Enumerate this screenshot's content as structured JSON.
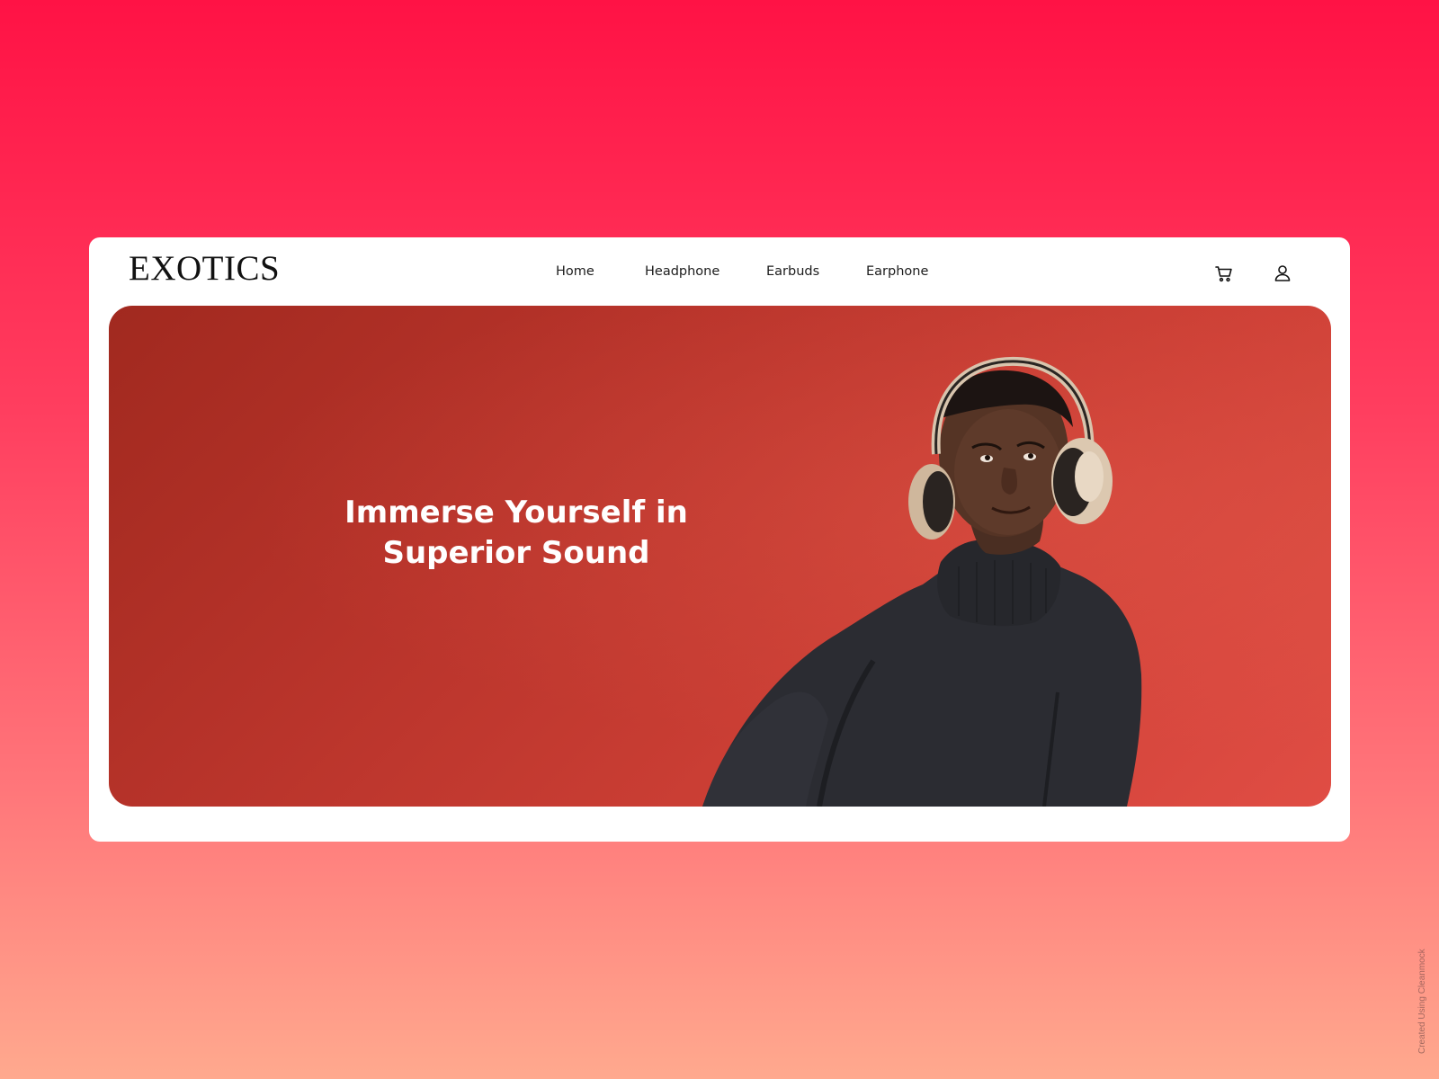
{
  "header": {
    "logo": "EXOTICS",
    "nav": [
      {
        "label": "Home"
      },
      {
        "label": "Headphone"
      },
      {
        "label": "Earbuds"
      },
      {
        "label": "Earphone"
      }
    ],
    "icons": [
      "cart-icon",
      "user-icon"
    ]
  },
  "hero": {
    "headline": "Immerse Yourself in Superior Sound",
    "image": "man-wearing-headphones-photo"
  },
  "watermark": "Created Using Cleanmock",
  "colors": {
    "page_gradient_top": "#ff1245",
    "page_gradient_bottom": "#ffa98e",
    "hero_background": "#c0392b",
    "card": "#ffffff"
  }
}
